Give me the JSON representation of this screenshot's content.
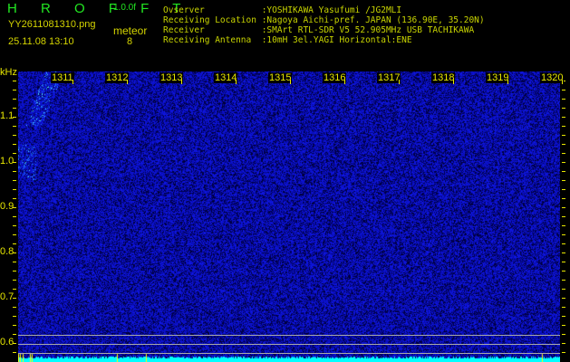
{
  "header": {
    "app_title": "H R O F F T",
    "version": "1.0.0f",
    "filename": "YY2611081310.png",
    "datetime": "25.11.08 13:10",
    "mode_label": "meteor",
    "count": "8"
  },
  "info": [
    {
      "label": "Ovserver          ",
      "value": ":YOSHIKAWA Yasufumi /JG2MLI"
    },
    {
      "label": "Receiving Location",
      "value": ":Nagoya Aichi-pref. JAPAN (136.90E, 35.20N)"
    },
    {
      "label": "Receiver          ",
      "value": ":SMArt RTL-SDR V5 52.905MHz USB TACHIKAWA"
    },
    {
      "label": "Receiving Antenna ",
      "value": ":10mH 3el.YAGI Horizontal:ENE"
    }
  ],
  "spectrogram": {
    "y_unit": "kHz",
    "y_labels": [
      "1.1",
      "1.0",
      "0.9",
      "0.8",
      "0.7",
      "0.6"
    ],
    "time_labels": [
      "1311",
      "1312",
      "1313",
      "1314",
      "1315",
      "1316",
      "1317",
      "1318",
      "1319",
      "1320"
    ],
    "colors": {
      "background": "#000020",
      "noise": "#1020e0",
      "signal": "#00ffff",
      "marker": "#ffff00"
    }
  }
}
